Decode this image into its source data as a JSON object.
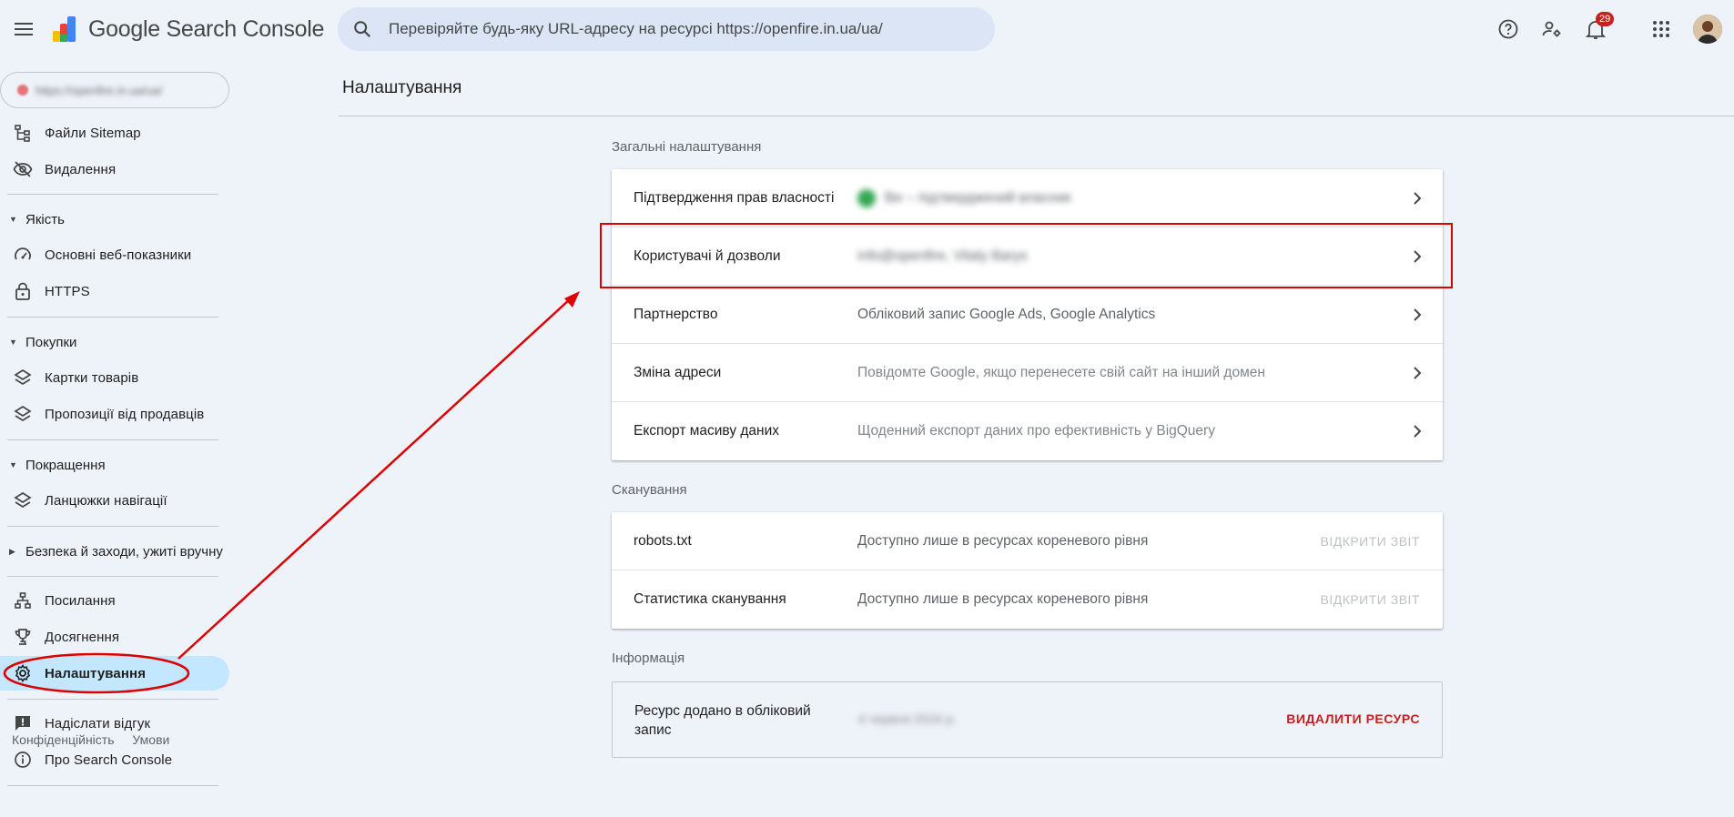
{
  "header": {
    "app_name": "Google Search Console",
    "search_placeholder": "Перевіряйте будь-яку URL-адресу на ресурсі https://openfire.in.ua/ua/",
    "notifications_count": "29"
  },
  "sidebar": {
    "property_label": "https://openfire.in.ua/ua/",
    "items_top": [
      {
        "label": "Файли Sitemap",
        "icon": "sitemap-icon"
      },
      {
        "label": "Видалення",
        "icon": "visibility-off-icon"
      }
    ],
    "sections": {
      "quality": "Якість",
      "shopping": "Покупки",
      "enhancements": "Покращення",
      "security": "Безпека й заходи, ужиті вручну"
    },
    "quality_items": [
      {
        "label": "Основні веб-показники",
        "icon": "speed-icon"
      },
      {
        "label": "HTTPS",
        "icon": "lock-icon"
      }
    ],
    "shopping_items": [
      {
        "label": "Картки товарів",
        "icon": "layers-icon"
      },
      {
        "label": "Пропозиції від продавців",
        "icon": "layers-icon"
      }
    ],
    "enhancement_items": [
      {
        "label": "Ланцюжки навігації",
        "icon": "layers-icon"
      }
    ],
    "bottom_items": [
      {
        "label": "Посилання",
        "icon": "links-icon"
      },
      {
        "label": "Досягнення",
        "icon": "trophy-icon"
      },
      {
        "label": "Налаштування",
        "icon": "gear-icon",
        "active": true
      }
    ],
    "feedback": "Надіслати відгук",
    "about": "Про Search Console",
    "footer": {
      "privacy": "Конфіденційність",
      "terms": "Умови"
    }
  },
  "main": {
    "title": "Налаштування",
    "general": {
      "heading": "Загальні налаштування",
      "rows": [
        {
          "label": "Підтвердження прав власності",
          "value": "Ви – підтверджений власник"
        },
        {
          "label": "Користувачі й дозволи",
          "value": "info@openfire, Vitaly Barys"
        },
        {
          "label": "Партнерство",
          "value": "Обліковий запис Google Ads, Google Analytics"
        },
        {
          "label": "Зміна адреси",
          "value": "Повідомте Google, якщо перенесете свій сайт на інший домен"
        },
        {
          "label": "Експорт масиву даних",
          "value": "Щоденний експорт даних про ефективність у BigQuery"
        }
      ]
    },
    "crawling": {
      "heading": "Сканування",
      "rows": [
        {
          "label": "robots.txt",
          "value": "Доступно лише в ресурсах кореневого рівня",
          "action": "ВІДКРИТИ ЗВІТ"
        },
        {
          "label": "Статистика сканування",
          "value": "Доступно лише в ресурсах кореневого рівня",
          "action": "ВІДКРИТИ ЗВІТ"
        }
      ]
    },
    "info": {
      "heading": "Інформація",
      "label": "Ресурс додано в обліковий запис",
      "value": "4 червня 2024 р.",
      "action": "ВИДАЛИТИ РЕСУРС"
    }
  },
  "colors": {
    "accent": "#c2e7ff",
    "danger": "#c5221f",
    "annotation": "#dd0000"
  }
}
